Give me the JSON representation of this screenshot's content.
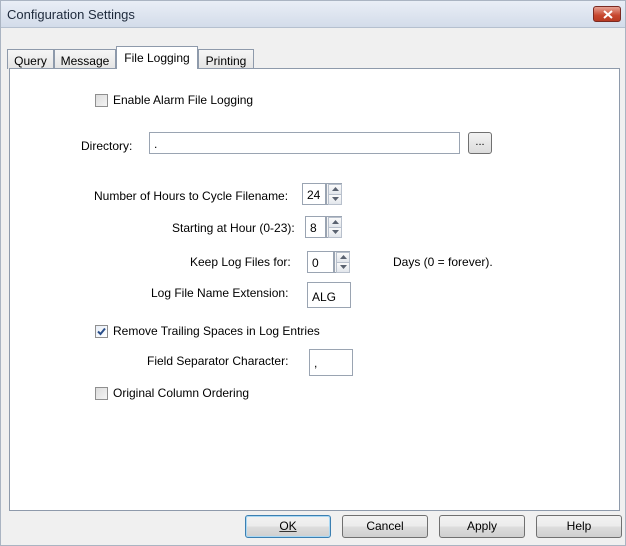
{
  "window": {
    "title": "Configuration Settings"
  },
  "tabs": [
    "Query",
    "Message",
    "File Logging",
    "Printing"
  ],
  "active_tab": "File Logging",
  "file_logging": {
    "enable_alarm_file_logging": {
      "label": "Enable Alarm File Logging",
      "checked": false
    },
    "directory": {
      "label": "Directory:",
      "value": ".",
      "browse_label": "..."
    },
    "hours_to_cycle": {
      "label": "Number of Hours to Cycle Filename:",
      "value": "24"
    },
    "starting_hour": {
      "label": "Starting at Hour (0-23):",
      "value": "8"
    },
    "keep_log_files": {
      "label": "Keep Log Files for:",
      "value": "0",
      "hint": "Days (0 = forever)."
    },
    "extension": {
      "label": "Log File Name Extension:",
      "value": "ALG"
    },
    "remove_trailing_spaces": {
      "label": "Remove Trailing Spaces in Log Entries",
      "checked": true
    },
    "field_separator": {
      "label": "Field Separator Character:",
      "value": ","
    },
    "original_column_ordering": {
      "label": "Original Column Ordering",
      "checked": false
    }
  },
  "buttons": {
    "ok": "OK",
    "cancel": "Cancel",
    "apply": "Apply",
    "help": "Help"
  },
  "colors": {
    "close_button": "#c7472f",
    "tab_border": "#8e9aab",
    "check_mark": "#2a4f8a"
  }
}
